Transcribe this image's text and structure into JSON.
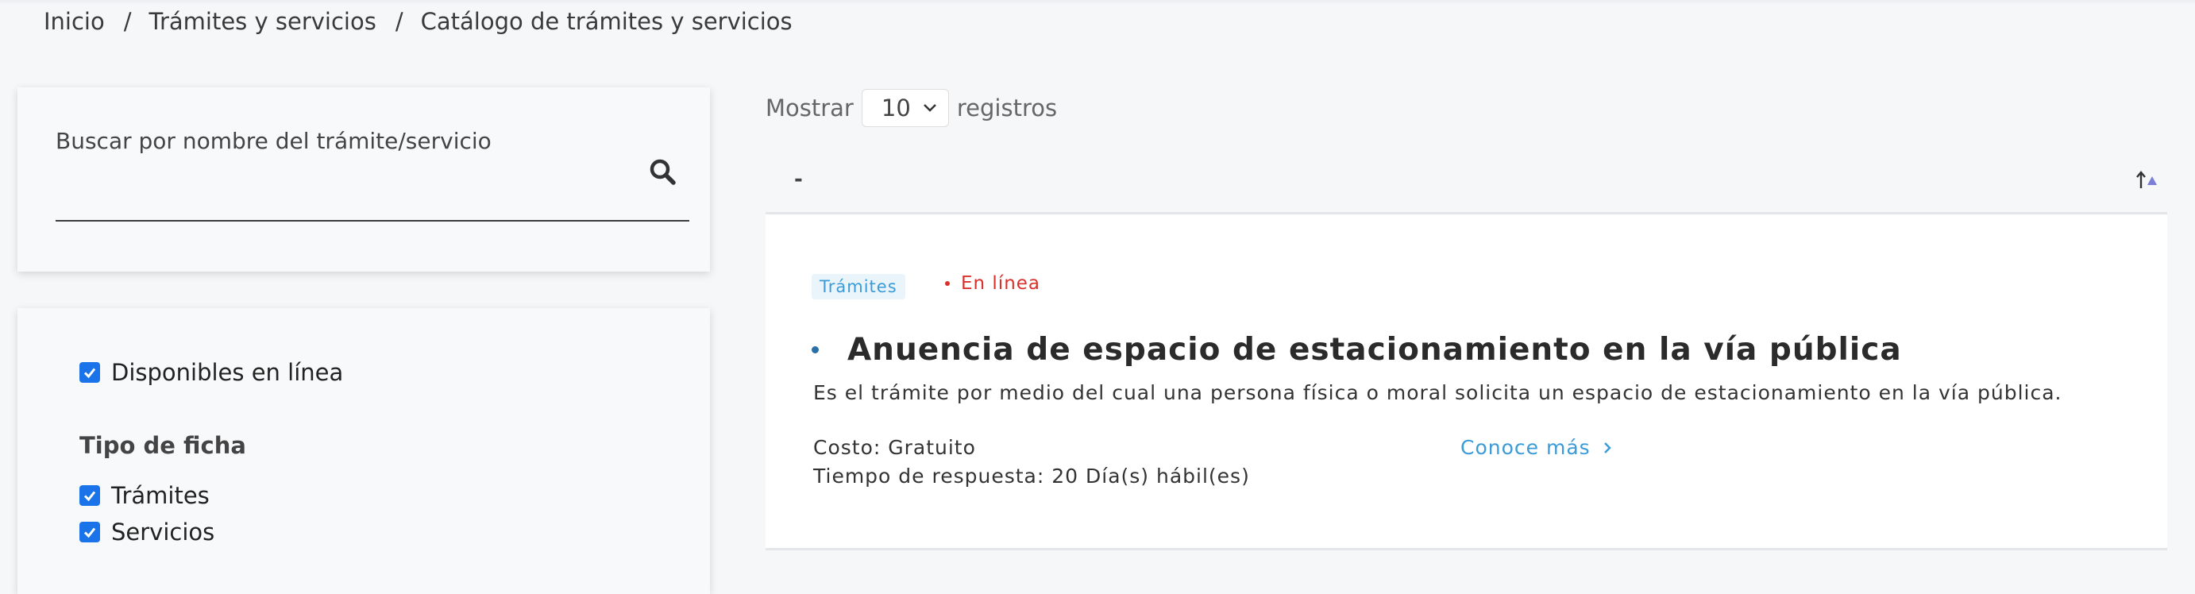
{
  "breadcrumb": {
    "items": [
      "Inicio",
      "Trámites y servicios",
      "Catálogo de trámites y servicios"
    ],
    "separator": "/"
  },
  "search": {
    "label": "Buscar por nombre del trámite/servicio",
    "placeholder": "",
    "icon": "search-icon"
  },
  "filters": {
    "online": {
      "label": "Disponibles en línea",
      "checked": true
    },
    "type_title": "Tipo de ficha",
    "types": [
      {
        "label": "Trámites",
        "checked": true
      },
      {
        "label": "Servicios",
        "checked": true
      }
    ]
  },
  "listing": {
    "show_prefix": "Mostrar",
    "page_size": "10",
    "show_suffix": "registros",
    "header_label": "-",
    "sort_icon": "sort-ascending-icon"
  },
  "results": [
    {
      "category": "Trámites",
      "status": "En línea",
      "title": "Anuencia de espacio de estacionamiento en la vía pública",
      "description": "Es el trámite por medio del cual una persona física o moral solicita un espacio de estacionamiento en la vía pública.",
      "cost": "Costo: Gratuito",
      "response_time": "Tiempo de respuesta: 20 Día(s) hábil(es)",
      "more_label": "Conoce más"
    }
  ],
  "colors": {
    "accent_blue": "#3b9bd8",
    "status_red": "#d9302c",
    "checkbox_blue": "#1a73e8"
  }
}
